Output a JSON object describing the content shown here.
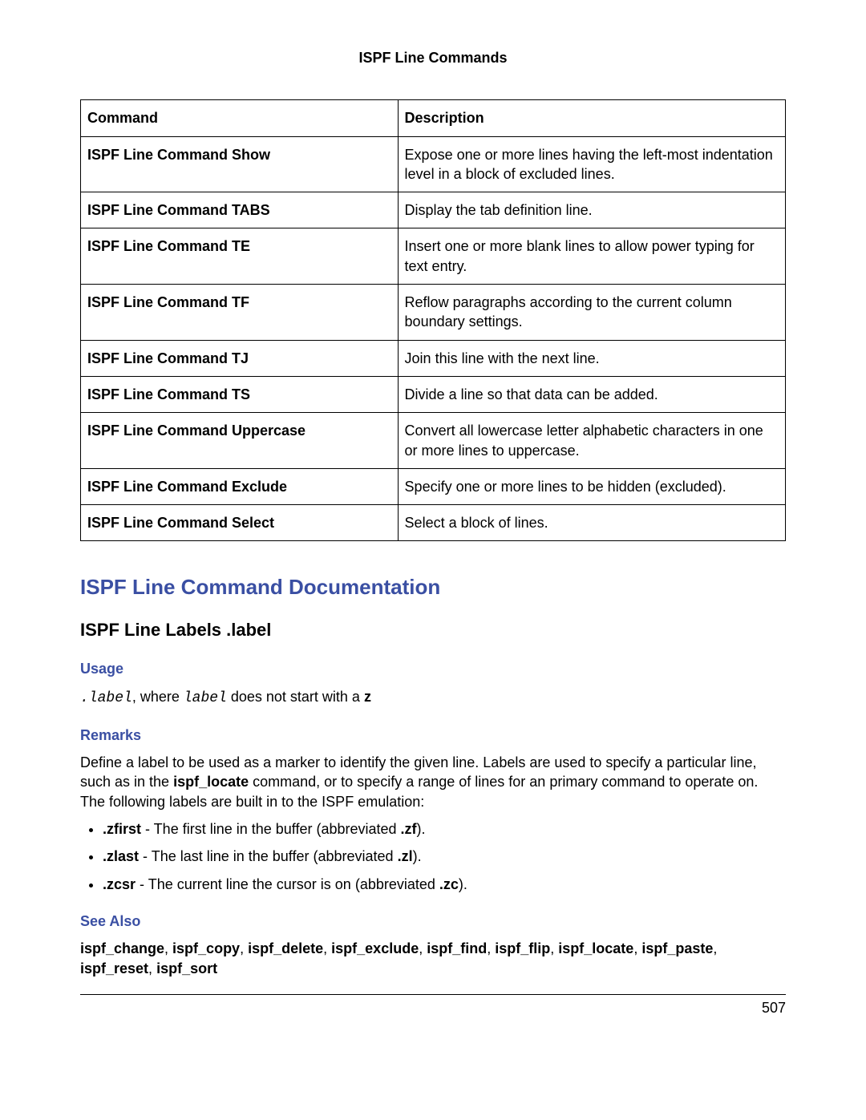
{
  "header": "ISPF Line Commands",
  "table": {
    "col1": "Command",
    "col2": "Description",
    "rows": [
      {
        "cmd": "ISPF Line Command Show",
        "desc": "Expose one or more lines having the left-most indentation level in a block of excluded lines."
      },
      {
        "cmd": "ISPF Line Command TABS",
        "desc": "Display the tab definition line."
      },
      {
        "cmd": "ISPF Line Command TE",
        "desc": "Insert one or more blank lines to allow power typing for text entry."
      },
      {
        "cmd": "ISPF Line Command TF",
        "desc": "Reflow paragraphs according to the current column boundary settings."
      },
      {
        "cmd": "ISPF Line Command TJ",
        "desc": "Join this line with the next line."
      },
      {
        "cmd": "ISPF Line Command TS",
        "desc": "Divide a line so that data can be added."
      },
      {
        "cmd": "ISPF Line Command Uppercase",
        "desc": "Convert all lowercase letter alphabetic characters in one or more lines to uppercase."
      },
      {
        "cmd": "ISPF Line Command Exclude",
        "desc": "Specify one or more lines to be hidden (excluded)."
      },
      {
        "cmd": "ISPF Line Command Select",
        "desc": "Select a block of lines."
      }
    ]
  },
  "sections": {
    "doc_title": "ISPF Line Command Documentation",
    "labels_title": "ISPF Line Labels .label",
    "usage_h": "Usage",
    "usage_line_pre": ".label",
    "usage_line_mid": ", where ",
    "usage_line_var": "label",
    "usage_line_post": " does not start with a ",
    "usage_line_end": "z",
    "remarks_h": "Remarks",
    "remarks_intro_1": "Define a label to be used as a marker to identify the given line. Labels are used to specify a particular line, such as in the ",
    "remarks_intro_cmd": "ispf_locate",
    "remarks_intro_2": " command, or to specify a range of lines for an primary command to operate on. The following labels are built in to the ISPF emulation:",
    "bullets": {
      "b1_name": ".zfirst",
      "b1_mid": " - The first line in the buffer (abbreviated ",
      "b1_abbr": ".zf",
      "b1_end": ").",
      "b2_name": ".zlast",
      "b2_mid": " - The last line in the buffer (abbreviated ",
      "b2_abbr": ".zl",
      "b2_end": ").",
      "b3_name": ".zcsr",
      "b3_mid": " - The current line the cursor is on (abbreviated ",
      "b3_abbr": ".zc",
      "b3_end": ")."
    },
    "seealso_h": "See Also",
    "seealso": {
      "a": "ispf_change",
      "b": "ispf_copy",
      "c": "ispf_delete",
      "d": "ispf_exclude",
      "e": "ispf_find",
      "f": "ispf_flip",
      "g": "ispf_locate",
      "h": "ispf_paste",
      "i": "ispf_reset",
      "j": "ispf_sort",
      "sep": ", "
    }
  },
  "page_num": "507"
}
